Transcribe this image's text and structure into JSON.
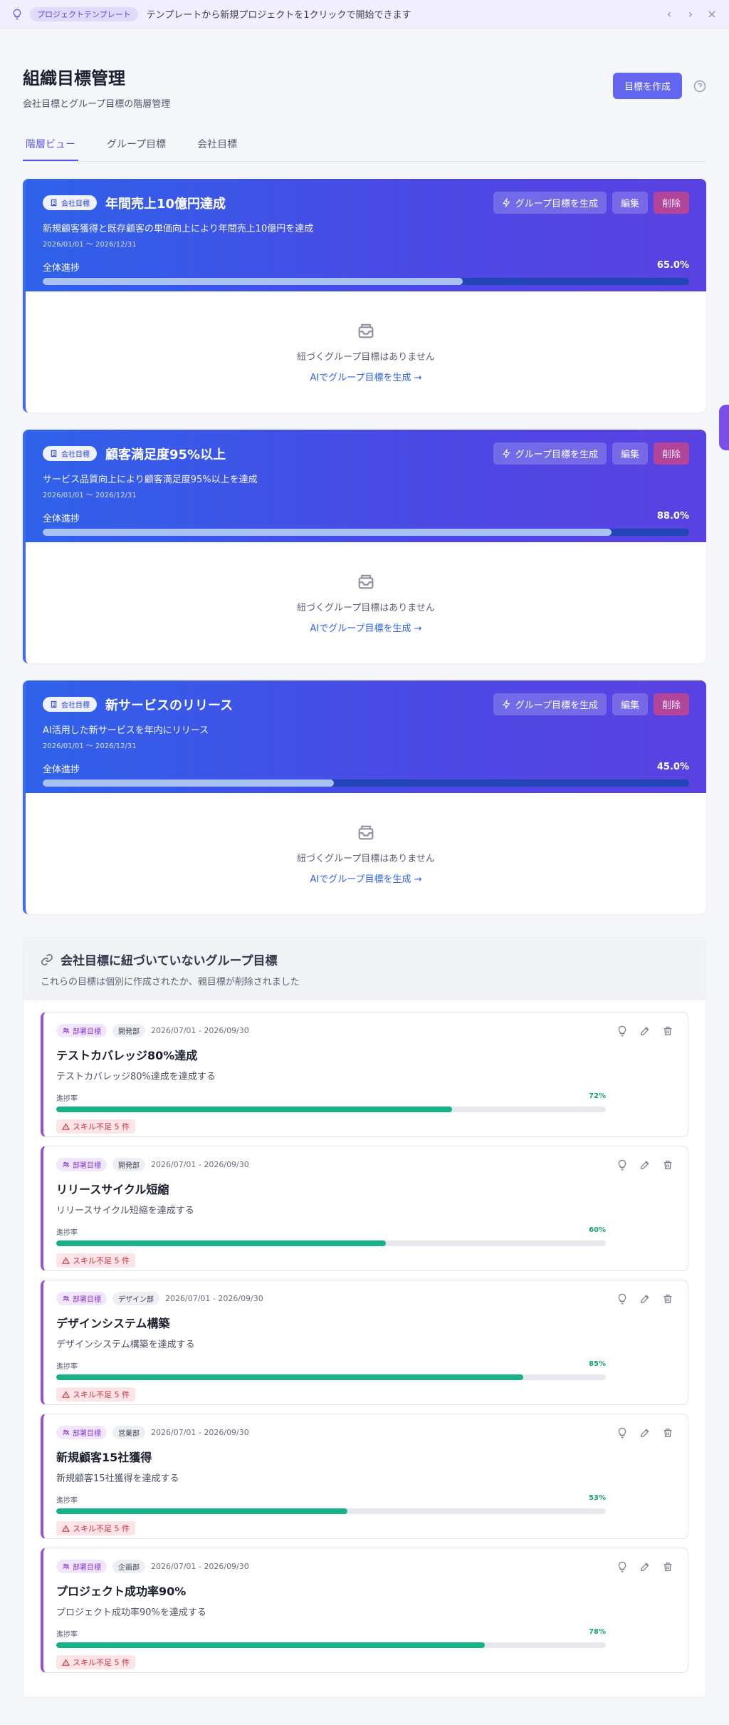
{
  "banner": {
    "pill": "プロジェクトテンプレート",
    "text": "テンプレートから新規プロジェクトを1クリックで開始できます"
  },
  "header": {
    "title": "組織目標管理",
    "subtitle": "会社目標とグループ目標の階層管理",
    "create_button": "目標を作成"
  },
  "tabs": [
    {
      "label": "階層ビュー",
      "active": true
    },
    {
      "label": "グループ目標",
      "active": false
    },
    {
      "label": "会社目標",
      "active": false
    }
  ],
  "company_goals": [
    {
      "badge": "会社目標",
      "title": "年間売上10億円達成",
      "description": "新規顧客獲得と既存顧客の単価向上により年間売上10億円を達成",
      "period": "2026/01/01 〜 2026/12/31",
      "progress_label": "全体進捗",
      "progress_text": "65.0%",
      "progress": 0.65,
      "btn_generate": "グループ目標を生成",
      "btn_edit": "編集",
      "btn_delete": "削除",
      "empty_text": "紐づくグループ目標はありません",
      "empty_link": "AIでグループ目標を生成 →"
    },
    {
      "badge": "会社目標",
      "title": "顧客満足度95%以上",
      "description": "サービス品質向上により顧客満足度95%以上を達成",
      "period": "2026/01/01 〜 2026/12/31",
      "progress_label": "全体進捗",
      "progress_text": "88.0%",
      "progress": 0.88,
      "btn_generate": "グループ目標を生成",
      "btn_edit": "編集",
      "btn_delete": "削除",
      "empty_text": "紐づくグループ目標はありません",
      "empty_link": "AIでグループ目標を生成 →"
    },
    {
      "badge": "会社目標",
      "title": "新サービスのリリース",
      "description": "AI活用した新サービスを年内にリリース",
      "period": "2026/01/01 〜 2026/12/31",
      "progress_label": "全体進捗",
      "progress_text": "45.0%",
      "progress": 0.45,
      "btn_generate": "グループ目標を生成",
      "btn_edit": "編集",
      "btn_delete": "削除",
      "empty_text": "紐づくグループ目標はありません",
      "empty_link": "AIでグループ目標を生成 →"
    }
  ],
  "unlinked": {
    "title": "会社目標に紐づいていないグループ目標",
    "subtitle": "これらの目標は個別に作成されたか、親目標が削除されました",
    "goals": [
      {
        "badge": "部署目標",
        "dept": "開発部",
        "period": "2026/07/01 - 2026/09/30",
        "title": "テストカバレッジ80%達成",
        "description": "テストカバレッジ80%達成を達成する",
        "progress_label": "進捗率",
        "progress_text": "72%",
        "progress": 0.72,
        "skill": "スキル不足 5 件"
      },
      {
        "badge": "部署目標",
        "dept": "開発部",
        "period": "2026/07/01 - 2026/09/30",
        "title": "リリースサイクル短縮",
        "description": "リリースサイクル短縮を達成する",
        "progress_label": "進捗率",
        "progress_text": "60%",
        "progress": 0.6,
        "skill": "スキル不足 5 件"
      },
      {
        "badge": "部署目標",
        "dept": "デザイン部",
        "period": "2026/07/01 - 2026/09/30",
        "title": "デザインシステム構築",
        "description": "デザインシステム構築を達成する",
        "progress_label": "進捗率",
        "progress_text": "85%",
        "progress": 0.85,
        "skill": "スキル不足 5 件"
      },
      {
        "badge": "部署目標",
        "dept": "営業部",
        "period": "2026/07/01 - 2026/09/30",
        "title": "新規顧客15社獲得",
        "description": "新規顧客15社獲得を達成する",
        "progress_label": "進捗率",
        "progress_text": "53%",
        "progress": 0.53,
        "skill": "スキル不足 5 件"
      },
      {
        "badge": "部署目標",
        "dept": "企画部",
        "period": "2026/07/01 - 2026/09/30",
        "title": "プロジェクト成功率90%",
        "description": "プロジェクト成功率90%を達成する",
        "progress_label": "進捗率",
        "progress_text": "78%",
        "progress": 0.78,
        "skill": "スキル不足 5 件"
      }
    ]
  }
}
